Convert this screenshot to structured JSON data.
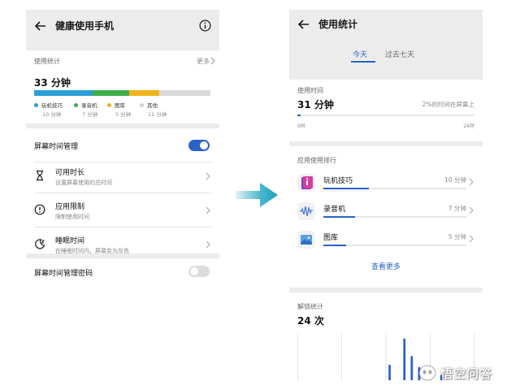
{
  "colors": {
    "accent": "#2a62c8",
    "arrow": "#29a9c4",
    "seg_games": "#2b9fd6",
    "seg_recorder": "#3fae49",
    "seg_gallery": "#f0b41c",
    "seg_other": "#d9d9d9"
  },
  "left": {
    "header": {
      "title": "健康使用手机",
      "back_icon": "arrow-left-icon",
      "info_icon": "info-icon"
    },
    "usage": {
      "label": "使用统计",
      "more": "更多",
      "total": "33 分钟",
      "bar_fractions": [
        0.33,
        0.21,
        0.17,
        0.29
      ],
      "legend": [
        {
          "name": "玩机技巧",
          "value": "10 分钟"
        },
        {
          "name": "录音机",
          "value": "7 分钟"
        },
        {
          "name": "图库",
          "value": "5 分钟"
        },
        {
          "name": "其他",
          "value": "11 分钟"
        }
      ]
    },
    "settings": {
      "screen_time": {
        "label": "屏幕时间管理",
        "enabled": true
      },
      "items": [
        {
          "title": "可用时长",
          "subtitle": "设置屏幕使用的总时间",
          "icon": "hourglass-icon"
        },
        {
          "title": "应用限制",
          "subtitle": "限制使用时间",
          "icon": "limit-alert-icon"
        },
        {
          "title": "睡眠时间",
          "subtitle": "在睡眠时间内，屏幕变为灰色",
          "icon": "moon-sleep-icon"
        }
      ]
    },
    "password": {
      "label": "屏幕时间管理密码",
      "enabled": false
    }
  },
  "right": {
    "header": {
      "title": "使用统计",
      "back_icon": "arrow-left-icon"
    },
    "tabs": [
      {
        "label": "今天",
        "active": true
      },
      {
        "label": "过去七天",
        "active": false
      }
    ],
    "usage_time": {
      "label": "使用时间",
      "total": "31 分钟",
      "percent_text": "2%的时间在屏幕上",
      "progress": 0.02,
      "axis_start": "0时",
      "axis_end": "24时"
    },
    "ranking": {
      "label": "应用使用排行",
      "apps": [
        {
          "name": "玩机技巧",
          "time": "10 分钟",
          "fraction": 0.32,
          "icon": "tips-app-icon"
        },
        {
          "name": "录音机",
          "time": "7 分钟",
          "fraction": 0.22,
          "icon": "recorder-app-icon"
        },
        {
          "name": "图库",
          "time": "5 分钟",
          "fraction": 0.16,
          "icon": "gallery-app-icon"
        }
      ],
      "see_more": "查看更多"
    },
    "unlocks": {
      "label": "解锁统计",
      "count": "24 次",
      "hourly_fractions": [
        0,
        0,
        0,
        0,
        0,
        0,
        0,
        0,
        0,
        0,
        0,
        0,
        0.35,
        0,
        0.95,
        0.55,
        0.3,
        0,
        0,
        0.12,
        0,
        0,
        0,
        0
      ]
    }
  },
  "watermark": {
    "text": "悟空问答"
  }
}
